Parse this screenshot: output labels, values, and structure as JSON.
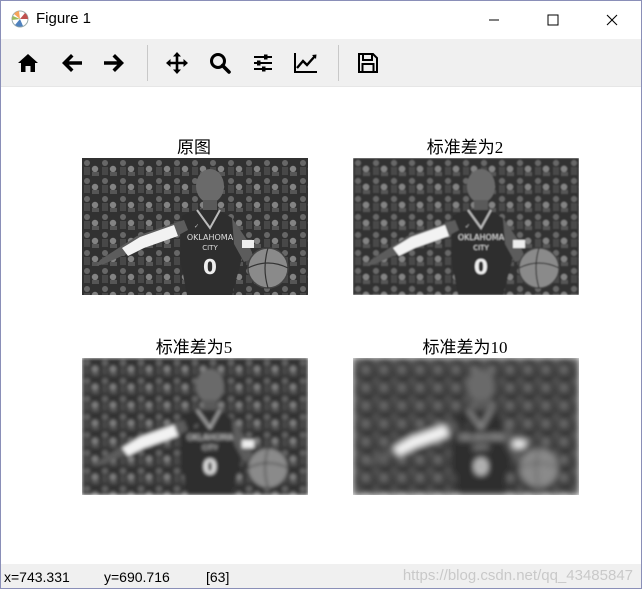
{
  "window": {
    "title": "Figure 1"
  },
  "toolbar": {
    "buttons": [
      {
        "name": "home",
        "icon": "home-icon"
      },
      {
        "name": "back",
        "icon": "arrow-left-icon"
      },
      {
        "name": "forward",
        "icon": "arrow-right-icon"
      },
      {
        "name": "pan",
        "icon": "move-icon"
      },
      {
        "name": "zoom",
        "icon": "zoom-icon"
      },
      {
        "name": "configure-subplots",
        "icon": "sliders-icon"
      },
      {
        "name": "edit-axis",
        "icon": "line-chart-icon"
      },
      {
        "name": "save",
        "icon": "save-icon"
      }
    ]
  },
  "subplots": [
    {
      "title": "原图"
    },
    {
      "title": "标准差为2"
    },
    {
      "title": "标准差为5"
    },
    {
      "title": "标准差为10"
    }
  ],
  "status": {
    "x": "x=743.331",
    "y": "y=690.716",
    "value": "[63]",
    "watermark": "https://blog.csdn.net/qq_43485847"
  }
}
